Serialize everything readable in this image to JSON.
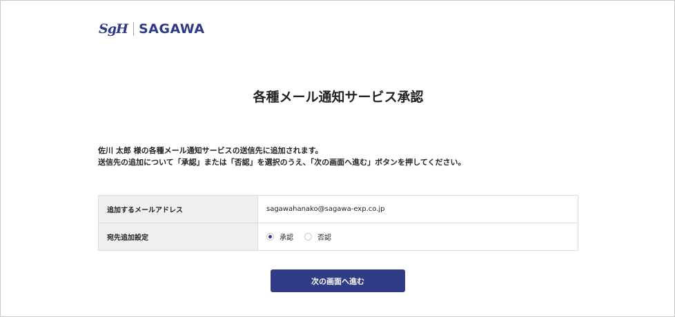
{
  "header": {
    "logo_mark": "SgH",
    "logo_name": "SAGAWA"
  },
  "page_title": "各種メール通知サービス承認",
  "intro": {
    "line1": "佐川 太郎 様の各種メール通知サービスの送信先に追加されます。",
    "line2": "送信先の追加について「承認」または「否認」を選択のうえ、「次の画面へ進む」ボタンを押してください。"
  },
  "form": {
    "email_label": "追加するメールアドレス",
    "email_value": "sagawahanako@sagawa-exp.co.jp",
    "setting_label": "宛先追加設定",
    "options": [
      {
        "label": "承認",
        "selected": true
      },
      {
        "label": "否認",
        "selected": false
      }
    ]
  },
  "next_button_label": "次の画面へ進む",
  "colors": {
    "brand": "#2e3a87",
    "button": "#313c86"
  }
}
